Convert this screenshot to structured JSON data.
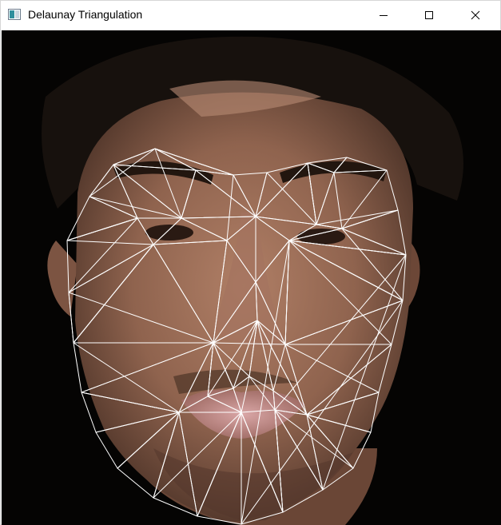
{
  "window": {
    "title": "Delaunay Triangulation",
    "controls": {
      "minimize_icon": "minimize-icon",
      "maximize_icon": "maximize-icon",
      "close_icon": "close-icon"
    }
  },
  "image": {
    "subject": "face photo with Delaunay triangulation mesh overlay",
    "mesh_color": "#ffffff",
    "background_color": "#050403"
  }
}
